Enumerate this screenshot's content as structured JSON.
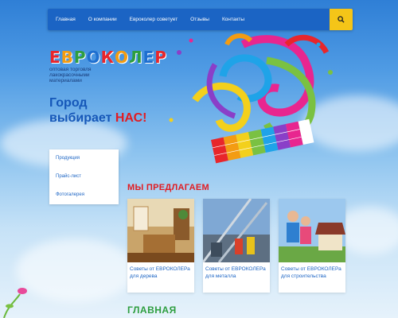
{
  "nav": {
    "items": [
      {
        "label": "Главная"
      },
      {
        "label": "О компании"
      },
      {
        "label": "Евроколер советует"
      },
      {
        "label": "Отзывы"
      },
      {
        "label": "Контакты"
      }
    ],
    "search_icon": "search-icon",
    "search_color": "#f5c518"
  },
  "logo": {
    "title": "ЕВРОКОЛЕР",
    "subtitle": "оптовая торговля лакокрасочными материалами"
  },
  "slogan": {
    "line1": "Город",
    "line2_prefix": "выбирает",
    "line2_highlight": "НАС!"
  },
  "sidebar": {
    "items": [
      {
        "label": "Продукция"
      },
      {
        "label": "Прайс-лист"
      },
      {
        "label": "Фотогалерея"
      }
    ]
  },
  "offers": {
    "title": "МЫ ПРЕДЛАГАЕМ",
    "cards": [
      {
        "label": "Советы от ЕВРОКОЛЕРа для дерева"
      },
      {
        "label": "Советы от ЕВРОКОЛЕРа для металла"
      },
      {
        "label": "Советы от ЕВРОКОЛЕРа для строительства"
      }
    ]
  },
  "main_section": {
    "title": "ГЛАВНАЯ"
  },
  "colors": {
    "nav_bg": "#1b64c4",
    "accent_red": "#e11c22",
    "accent_green": "#2e9e3f",
    "link_blue": "#1b64c4"
  }
}
